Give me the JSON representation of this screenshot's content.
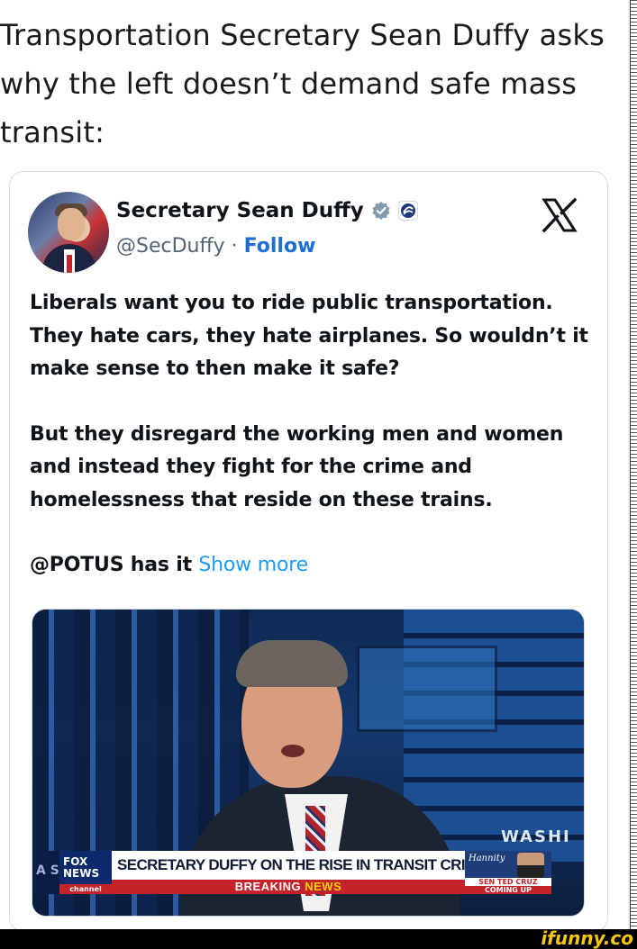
{
  "headline": "Transportation Secretary Sean Duffy asks why the left doesn’t demand safe mass transit:",
  "tweet": {
    "display_name": "Secretary Sean Duffy",
    "handle": "@SecDuffy",
    "separator": " · ",
    "follow_label": "Follow",
    "paragraph_1": "Liberals want you to ride public transportation. They hate cars, they hate airplanes. So wouldn’t it make sense to then make it safe?",
    "paragraph_2": "But they disregard the working men and women and instead they fight for the crime and homelessness that reside on these trains.",
    "paragraph_3_mention": "@POTUS",
    "paragraph_3_text": " has it ",
    "show_more": "Show more",
    "verified_icon": "verified-badge-icon",
    "government_icon": "government-affiliation-icon",
    "platform_icon": "x-logo-icon",
    "colors": {
      "link": "#1d9bf0",
      "follow": "#1d6fd6",
      "text": "#0f1419",
      "muted": "#536471"
    }
  },
  "video_still": {
    "chyron_headline": "SECRETARY DUFFY ON THE RISE IN TRANSIT CRIMES",
    "breaking_word": "BREAKING",
    "news_word": "NEWS",
    "network_logo_top": "FOX",
    "network_logo_bottom": "NEWS",
    "network_channel": "channel",
    "backdrop_text": "WASHI",
    "left_edge_text": "A S",
    "promo_show": "Hannity",
    "promo_guest": "SEN TED CRUZ",
    "promo_when": "COMING UP"
  },
  "watermark": {
    "brand": "ifunny.co",
    "color": "#f6c90e"
  }
}
